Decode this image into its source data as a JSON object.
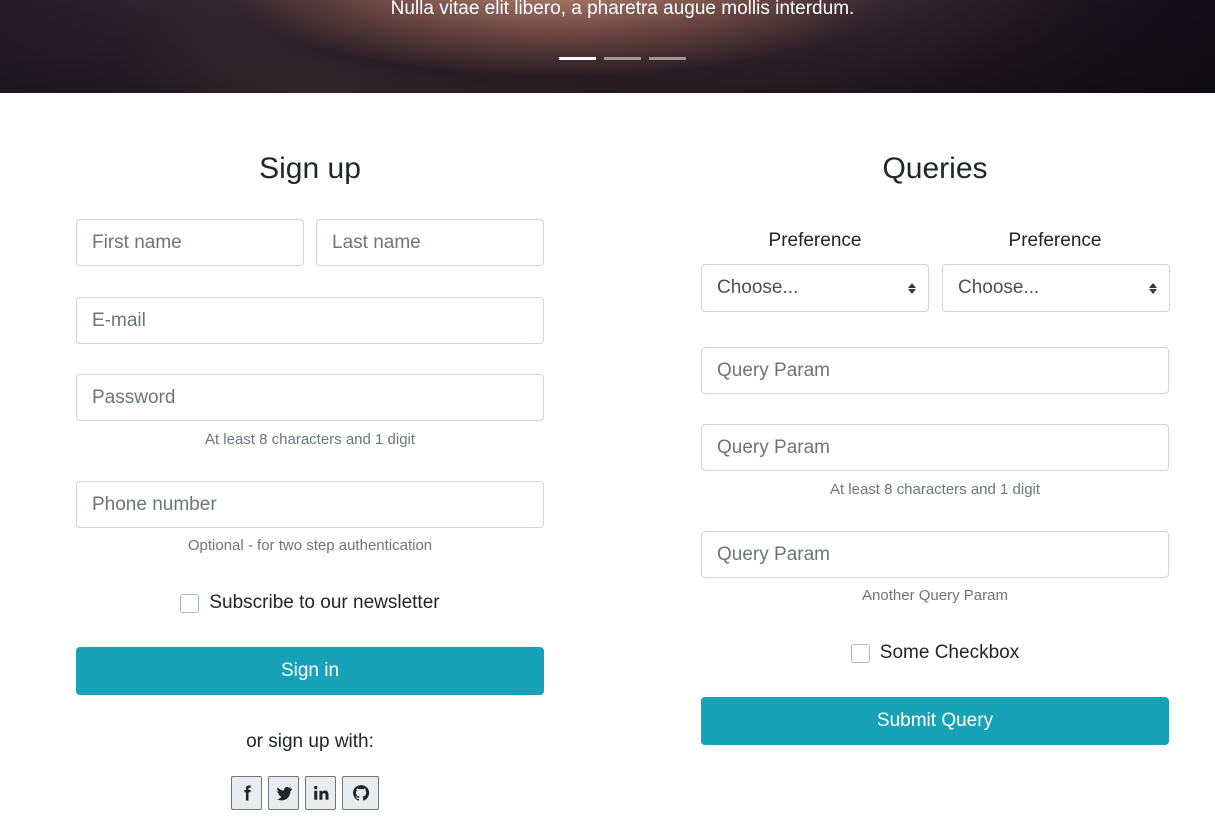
{
  "carousel": {
    "caption": "Nulla vitae elit libero, a pharetra augue mollis interdum.",
    "slide_count": 3,
    "active_slide": 1
  },
  "signup": {
    "title": "Sign up",
    "first_name_placeholder": "First name",
    "last_name_placeholder": "Last name",
    "email_placeholder": "E-mail",
    "password_placeholder": "Password",
    "password_help": "At least 8 characters and 1 digit",
    "phone_placeholder": "Phone number",
    "phone_help": "Optional - for two step authentication",
    "newsletter_label": "Subscribe to our newsletter",
    "submit_label": "Sign in",
    "social_text": "or sign up with:",
    "social_icons": [
      "facebook-icon",
      "twitter-icon",
      "linkedin-icon",
      "github-icon"
    ]
  },
  "queries": {
    "title": "Queries",
    "preference_1_label": "Preference",
    "preference_2_label": "Preference",
    "preference_1_value": "Choose...",
    "preference_2_value": "Choose...",
    "param_1_placeholder": "Query Param",
    "param_2_placeholder": "Query Param",
    "param_2_help": "At least 8 characters and 1 digit",
    "param_3_placeholder": "Query Param",
    "param_3_help": "Another Query Param",
    "checkbox_label": "Some Checkbox",
    "submit_label": "Submit Query"
  },
  "colors": {
    "primary_button": "#17a2b8",
    "muted_text": "#6c757d",
    "input_border": "#ced4da"
  }
}
